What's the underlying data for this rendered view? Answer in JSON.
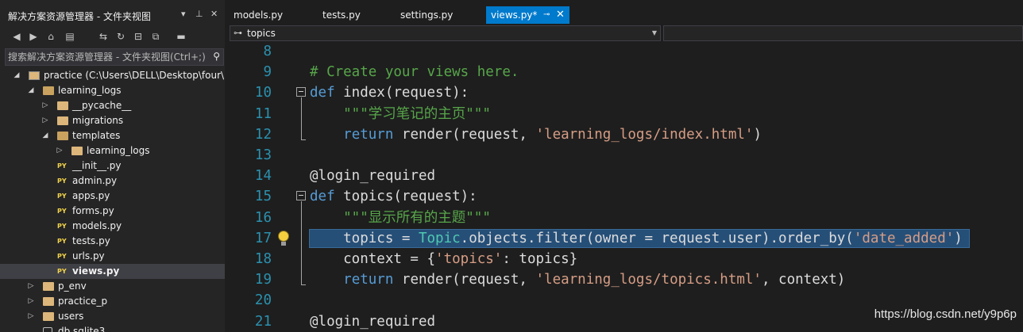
{
  "explorer": {
    "title": "解决方案资源管理器 - 文件夹视图",
    "search_placeholder": "搜索解决方案资源管理器 - 文件夹视图(Ctrl+;)",
    "tree": [
      {
        "label": "practice (C:\\Users\\DELL\\Desktop\\four\\l",
        "kind": "project",
        "expanded": true
      },
      {
        "label": "learning_logs",
        "kind": "folder",
        "expanded": true
      },
      {
        "label": "__pycache__",
        "kind": "folder",
        "expanded": false
      },
      {
        "label": "migrations",
        "kind": "folder",
        "expanded": false
      },
      {
        "label": "templates",
        "kind": "folder",
        "expanded": true
      },
      {
        "label": "learning_logs",
        "kind": "folder",
        "expanded": false
      },
      {
        "label": "__init__.py",
        "kind": "py"
      },
      {
        "label": "admin.py",
        "kind": "py"
      },
      {
        "label": "apps.py",
        "kind": "py"
      },
      {
        "label": "forms.py",
        "kind": "py"
      },
      {
        "label": "models.py",
        "kind": "py"
      },
      {
        "label": "tests.py",
        "kind": "py"
      },
      {
        "label": "urls.py",
        "kind": "py"
      },
      {
        "label": "views.py",
        "kind": "py",
        "selected": true
      },
      {
        "label": "p_env",
        "kind": "folder",
        "expanded": false
      },
      {
        "label": "practice_p",
        "kind": "folder",
        "expanded": false
      },
      {
        "label": "users",
        "kind": "folder",
        "expanded": false
      },
      {
        "label": "db.sqlite3",
        "kind": "db"
      }
    ],
    "py_badge": "PY"
  },
  "tabs": [
    {
      "label": "models.py"
    },
    {
      "label": "tests.py"
    },
    {
      "label": "settings.py"
    },
    {
      "label": "views.py*",
      "active": true
    }
  ],
  "navbar": {
    "scope": "topics"
  },
  "code": {
    "line_numbers": [
      "8",
      "9",
      "10",
      "11",
      "12",
      "13",
      "14",
      "15",
      "16",
      "17",
      "18",
      "19",
      "20",
      "21"
    ],
    "lines": [
      [],
      [
        {
          "t": "# Create your views here.",
          "c": "cm"
        }
      ],
      [
        {
          "t": "def",
          "c": "kw"
        },
        {
          "t": " index(request):",
          "c": "pl"
        }
      ],
      [
        {
          "t": "    \"\"\"学习笔记的主页\"\"\"",
          "c": "doc"
        }
      ],
      [
        {
          "t": "    ",
          "c": "pl"
        },
        {
          "t": "return",
          "c": "kw"
        },
        {
          "t": " render(request, ",
          "c": "pl"
        },
        {
          "t": "'learning_logs/index.html'",
          "c": "st"
        },
        {
          "t": ")",
          "c": "pl"
        }
      ],
      [],
      [
        {
          "t": "@login_required",
          "c": "pl"
        }
      ],
      [
        {
          "t": "def",
          "c": "kw"
        },
        {
          "t": " topics(request):",
          "c": "pl"
        }
      ],
      [
        {
          "t": "    \"\"\"显示所有的主题\"\"\"",
          "c": "doc"
        }
      ],
      [
        {
          "t": "    topics = ",
          "c": "pl"
        },
        {
          "t": "Topic",
          "c": "ty"
        },
        {
          "t": ".objects.filter(owner = request.user).order_by(",
          "c": "pl"
        },
        {
          "t": "'date_added'",
          "c": "st"
        },
        {
          "t": ")",
          "c": "pl"
        }
      ],
      [
        {
          "t": "    context = {",
          "c": "pl"
        },
        {
          "t": "'topics'",
          "c": "st"
        },
        {
          "t": ": topics}",
          "c": "pl"
        }
      ],
      [
        {
          "t": "    ",
          "c": "pl"
        },
        {
          "t": "return",
          "c": "kw"
        },
        {
          "t": " render(request, ",
          "c": "pl"
        },
        {
          "t": "'learning_logs/topics.html'",
          "c": "st"
        },
        {
          "t": ", context)",
          "c": "pl"
        }
      ],
      [],
      [
        {
          "t": "@login_required",
          "c": "pl"
        }
      ]
    ],
    "highlighted_line": "17"
  },
  "watermark": "https://blog.csdn.net/y9p6p",
  "colors": {
    "accent": "#007acc",
    "selection": "#264f78",
    "line_number": "#2b91af"
  }
}
